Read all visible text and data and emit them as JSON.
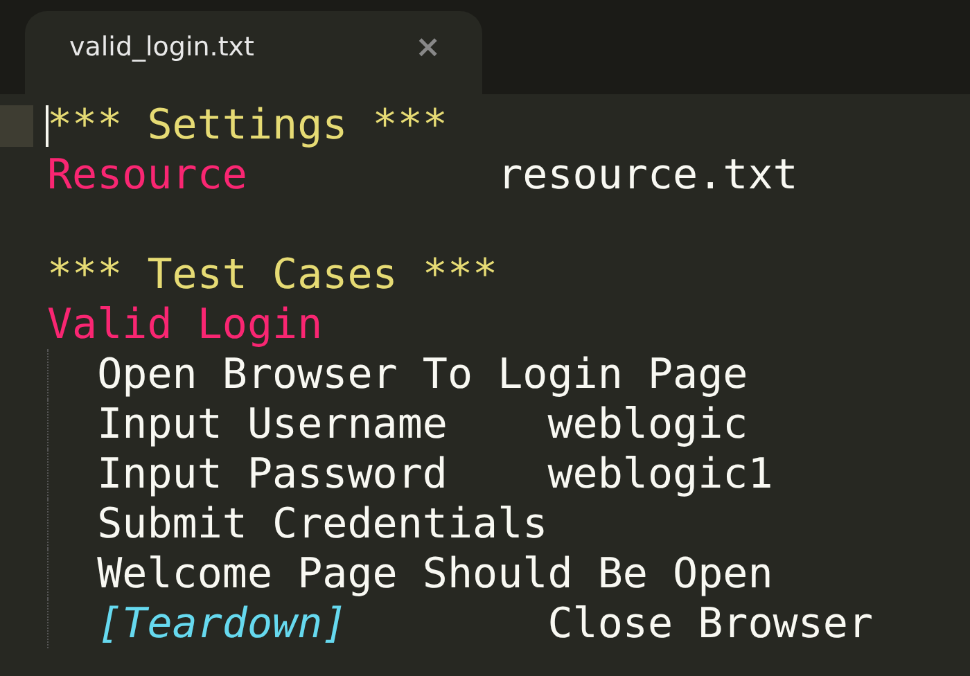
{
  "tab": {
    "title": "valid_login.txt",
    "close": "×"
  },
  "lines": [
    {
      "indent": false,
      "cursor": true,
      "tokens": [
        {
          "kind": "heading",
          "text": "*** Settings ***"
        }
      ]
    },
    {
      "indent": false,
      "cursor": false,
      "tokens": [
        {
          "kind": "name",
          "text": "Resource"
        },
        {
          "kind": "plain",
          "text": "resource.txt"
        }
      ]
    },
    {
      "indent": false,
      "cursor": false
    },
    {
      "indent": false,
      "cursor": false,
      "tokens": [
        {
          "kind": "heading",
          "text": "*** Test Cases ***"
        }
      ]
    },
    {
      "indent": false,
      "cursor": false,
      "tokens": [
        {
          "kind": "name",
          "text": "Valid Login"
        }
      ]
    },
    {
      "indent": true,
      "cursor": false,
      "tokens": [
        {
          "kind": "plain",
          "text": "Open Browser To Login Page"
        }
      ]
    },
    {
      "indent": true,
      "cursor": false,
      "tokens": [
        {
          "kind": "plain",
          "text": "Input Username"
        },
        {
          "kind": "plain",
          "text": "weblogic"
        }
      ]
    },
    {
      "indent": true,
      "cursor": false,
      "tokens": [
        {
          "kind": "plain",
          "text": "Input Password"
        },
        {
          "kind": "plain",
          "text": "weblogic1"
        }
      ]
    },
    {
      "indent": true,
      "cursor": false,
      "tokens": [
        {
          "kind": "plain",
          "text": "Submit Credentials"
        }
      ]
    },
    {
      "indent": true,
      "cursor": false,
      "tokens": [
        {
          "kind": "plain",
          "text": "Welcome Page Should Be Open"
        }
      ]
    },
    {
      "indent": true,
      "cursor": false,
      "tokens": [
        {
          "kind": "setting",
          "text": "[Teardown]"
        },
        {
          "kind": "plain",
          "text": "Close Browser"
        }
      ]
    }
  ]
}
